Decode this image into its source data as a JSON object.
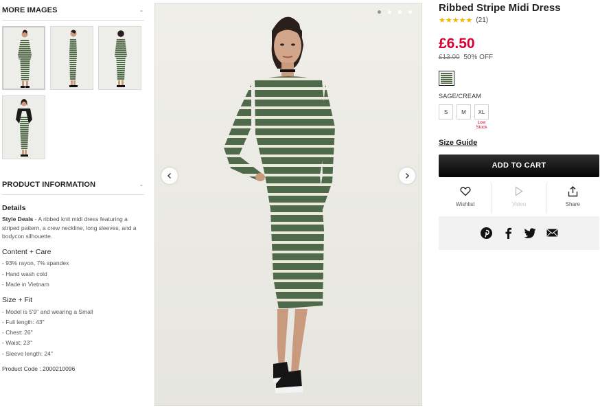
{
  "left": {
    "more_images": {
      "heading": "MORE IMAGES",
      "toggle": "-"
    },
    "thumbnails": [
      {
        "label": "front-view"
      },
      {
        "label": "side-view"
      },
      {
        "label": "back-view"
      },
      {
        "label": "jacket-view"
      }
    ],
    "product_information": {
      "heading": "PRODUCT INFORMATION",
      "toggle": "-",
      "details_heading": "Details",
      "details_lead": "Style Deals",
      "details_text": " - A ribbed knit midi dress featuring a striped pattern, a crew neckline, long sleeves, and a bodycon silhouette.",
      "content_heading": "Content + Care",
      "content_lines": [
        "- 93% rayon, 7% spandex",
        "- Hand wash cold",
        "- Made in Vietnam"
      ],
      "size_heading": "Size + Fit",
      "size_lines": [
        "- Model is 5'9\" and wearing a Small",
        "- Full length: 43\"",
        "- Chest: 26\"",
        "- Waist: 23\"",
        "- Sleeve length: 24\""
      ],
      "product_code": "Product Code : 2000210096"
    }
  },
  "gallery": {
    "dots": 4,
    "active_dot": 0,
    "prev_icon": "chevron-left-icon",
    "next_icon": "chevron-right-icon"
  },
  "product": {
    "title": "Ribbed Stripe Midi Dress",
    "stars": "★★★★★",
    "rating_value": 4.5,
    "review_count": "(21)",
    "price": "£6.50",
    "original_price": "£13.00",
    "discount": "50% OFF",
    "color_name": "SAGE/CREAM",
    "sizes": [
      "S",
      "M",
      "XL"
    ],
    "low_stock_label": "Low Stock",
    "size_guide": "Size Guide",
    "add_to_cart": "ADD TO CART",
    "actions": [
      {
        "label": "Wishlist",
        "icon": "heart-icon"
      },
      {
        "label": "Video",
        "icon": "play-icon"
      },
      {
        "label": "Share",
        "icon": "share-icon"
      }
    ],
    "share_icons": [
      "pinterest-icon",
      "facebook-icon",
      "twitter-icon",
      "email-icon"
    ]
  },
  "colors": {
    "price_red": "#d50032",
    "star_gold": "#f4b400",
    "stripe_green": "#4f6a4a",
    "stripe_cream": "#e9e6da"
  }
}
